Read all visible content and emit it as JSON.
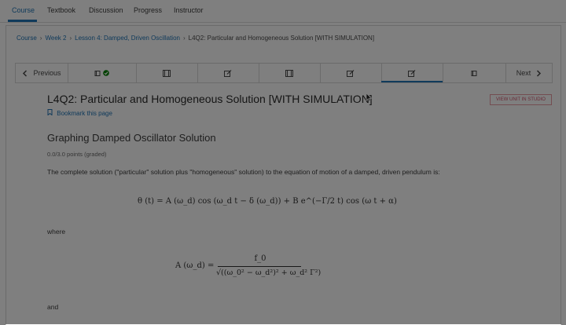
{
  "course_tabs": [
    "Course",
    "Textbook",
    "Discussion",
    "Progress",
    "Instructor"
  ],
  "breadcrumb": {
    "items": [
      "Course",
      "Week 2",
      "Lesson 4: Damped, Driven Oscillation"
    ],
    "current": "L4Q2: Particular and Homogeneous Solution [WITH SIMULATION]"
  },
  "sequence_nav": {
    "previous_label": "Previous",
    "next_label": "Next",
    "units": [
      {
        "icon": "book-icon",
        "completed": true,
        "active": false
      },
      {
        "icon": "video-icon",
        "completed": false,
        "active": false
      },
      {
        "icon": "problem-icon",
        "completed": false,
        "active": false
      },
      {
        "icon": "video-icon",
        "completed": false,
        "active": false
      },
      {
        "icon": "problem-icon",
        "completed": false,
        "active": false
      },
      {
        "icon": "problem-icon",
        "completed": false,
        "active": true
      },
      {
        "icon": "book-icon",
        "completed": false,
        "active": false
      }
    ]
  },
  "unit": {
    "title": "L4Q2: Particular and Homogeneous Solution [WITH SIMULATION]",
    "bookmark_label": "Bookmark this page",
    "studio_button": "VIEW UNIT IN STUDIO"
  },
  "problem": {
    "title": "Graphing Damped Oscillator Solution",
    "points": "0.0/3.0 points (graded)",
    "intro": "The complete solution (\"particular\" solution plus \"homogeneous\" solution) to the equation of motion of a damped, driven pendulum is:",
    "equation1": "θ (t) = A (ω_d) cos (ω_d t − δ (ω_d)) + B e^(−Γ/2 t) cos (ω t + α)",
    "where_label": "where",
    "equation2_lhs": "A (ω_d) =",
    "equation2_num": "f_0",
    "equation2_den": "√((ω_0² − ω_d²)² + ω_d² Γ²)",
    "and_label": "and"
  },
  "colors": {
    "accent": "#2075b6",
    "studio": "#d0516a",
    "overlay": "rgba(0,0,0,0.5)"
  }
}
